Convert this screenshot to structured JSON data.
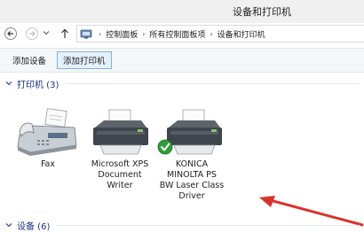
{
  "window": {
    "title": "设备和打印机"
  },
  "address": {
    "crumbs": [
      "控制面板",
      "所有控制面板项",
      "设备和打印机"
    ]
  },
  "toolbar": {
    "add_device_label": "添加设备",
    "add_printer_label": "添加打印机"
  },
  "groups": {
    "printers_label": "打印机 (3)",
    "devices_label": "设备 (6)"
  },
  "printers": [
    {
      "lines": [
        "Fax"
      ],
      "icon": "fax-icon"
    },
    {
      "lines": [
        "Microsoft XPS",
        "Document",
        "Writer"
      ],
      "icon": "printer-icon"
    },
    {
      "lines": [
        "KONICA",
        "MINOLTA PS",
        "BW Laser Class",
        "Driver"
      ],
      "icon": "printer-icon",
      "default": true
    }
  ],
  "colors": {
    "group_header": "#1e3287",
    "arrow": "#d9342b",
    "default_check": "#2f9e3a",
    "selected_button_border": "#7eb4ea"
  }
}
